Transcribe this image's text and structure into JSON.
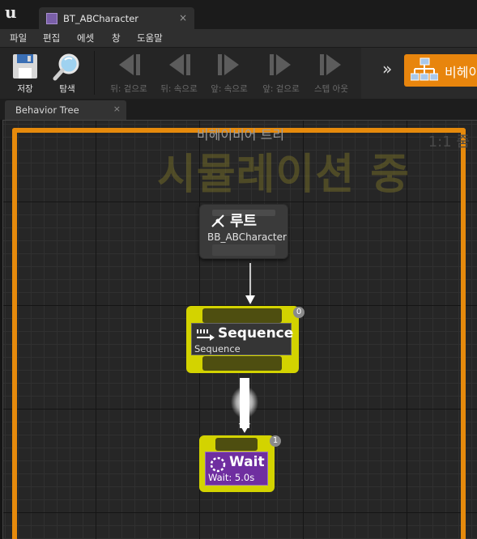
{
  "window": {
    "doc_tab_label": "BT_ABCharacter",
    "doc_tab_close": "×"
  },
  "menu": [
    "파일",
    "편집",
    "에셋",
    "창",
    "도움말"
  ],
  "toolbar": {
    "buttons": [
      {
        "label": "저장",
        "icon": "save-icon",
        "enabled": true
      },
      {
        "label": "탐색",
        "icon": "browse-magnifier-icon",
        "enabled": true
      },
      {
        "label": "뒤: 겉으로",
        "icon": "step-back-out-icon",
        "enabled": false
      },
      {
        "label": "뒤: 속으로",
        "icon": "step-back-into-icon",
        "enabled": false
      },
      {
        "label": "앞: 속으로",
        "icon": "step-forward-into-icon",
        "enabled": false
      },
      {
        "label": "앞: 겉으로",
        "icon": "step-forward-out-icon",
        "enabled": false
      },
      {
        "label": "스텝 아웃",
        "icon": "step-out-icon",
        "enabled": false
      }
    ],
    "mode_chevron": "»",
    "mode_button_label": "비헤이"
  },
  "panel_tab": {
    "label": "Behavior Tree",
    "close": "×"
  },
  "graph": {
    "title": "비헤이비어 트리",
    "zoom_label": "1:1 줌",
    "watermark": "시뮬레이션 중",
    "accent_color": "#e68a0c",
    "nodes": {
      "root": {
        "title": "루트",
        "subtitle": "BB_ABCharacter"
      },
      "sequence": {
        "title": "Sequence",
        "subtitle": "Sequence",
        "index": "0"
      },
      "wait": {
        "title": "Wait",
        "subtitle": "Wait: 5.0s",
        "index": "1"
      }
    }
  }
}
